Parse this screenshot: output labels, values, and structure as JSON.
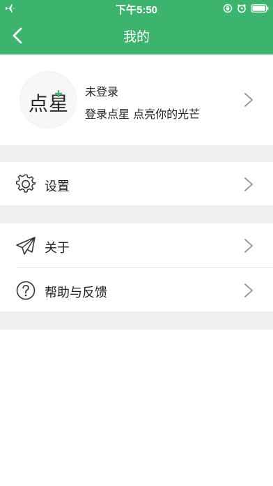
{
  "status_bar": {
    "time": "下午5:50",
    "left_icon": "airplane-icon",
    "right_icons": [
      "rotation-lock-icon",
      "alarm-icon",
      "battery-icon"
    ]
  },
  "nav": {
    "title": "我的",
    "back_icon": "chevron-left-icon"
  },
  "profile": {
    "avatar_logo_text": "点星",
    "name": "未登录",
    "slogan": "登录点星 点亮你的光芒"
  },
  "menu": [
    {
      "label": "设置",
      "icon": "gear-icon"
    },
    {
      "label": "关于",
      "icon": "paper-plane-icon"
    },
    {
      "label": "帮助与反馈",
      "icon": "question-circle-icon"
    }
  ],
  "colors": {
    "brand_green": "#3cb46e",
    "section_gap": "#efefef"
  }
}
